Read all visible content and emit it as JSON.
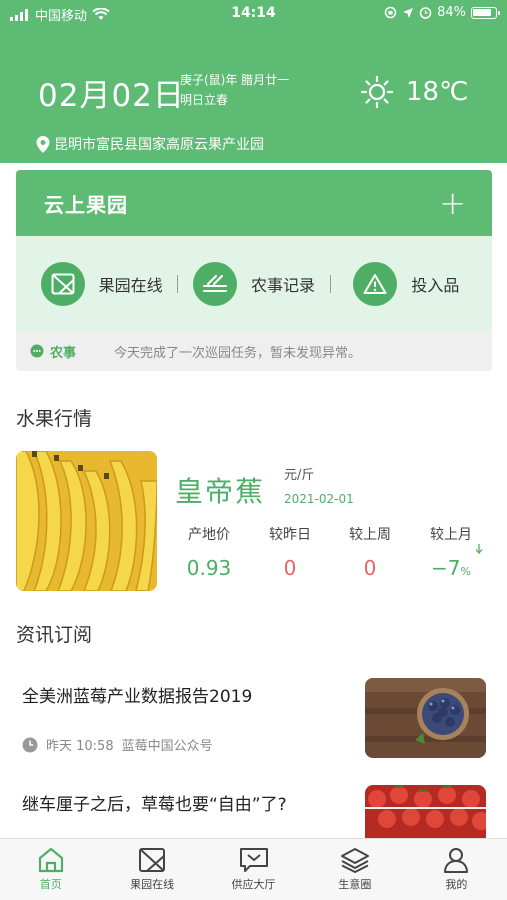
{
  "status_bar": {
    "carrier": "中国移动",
    "time": "14:14",
    "battery": "84%"
  },
  "header": {
    "date": "02月02日",
    "lunar_line1": "庚子(鼠)年 腊月廿一",
    "lunar_line2": "明日立春",
    "temperature": "18℃",
    "location": "昆明市富民县国家高原云果产业园"
  },
  "orchard_card": {
    "title": "云上果园",
    "functions": [
      {
        "label": "果园在线",
        "icon": "image-frame-icon"
      },
      {
        "label": "农事记录",
        "icon": "record-lines-icon"
      },
      {
        "label": "投入品",
        "icon": "warning-triangle-icon"
      }
    ],
    "notice_tag": "农事",
    "notice_text": "今天完成了一次巡园任务，暂未发现异常。"
  },
  "market": {
    "section_title": "水果行情",
    "fruit_name": "皇帝蕉",
    "unit": "元/斤",
    "date": "2021-02-01",
    "prices": [
      {
        "label": "产地价",
        "value": "0.93",
        "color": "#4fae66"
      },
      {
        "label": "较昨日",
        "value": "0",
        "color": "#e86666"
      },
      {
        "label": "较上周",
        "value": "0",
        "color": "#e86666"
      },
      {
        "label": "较上月",
        "value": "−7",
        "suffix": "%",
        "color": "#4fae66"
      }
    ]
  },
  "news_section": {
    "section_title": "资讯订阅",
    "items": [
      {
        "title": "全美洲蓝莓产业数据报告2019",
        "time": "昨天 10:58",
        "source": "蓝莓中国公众号"
      },
      {
        "title": "继车厘子之后，草莓也要“自由”了?"
      }
    ]
  },
  "tabbar": {
    "tabs": [
      {
        "label": "首页",
        "icon": "home-icon",
        "active": true
      },
      {
        "label": "果园在线",
        "icon": "image-frame-icon",
        "active": false
      },
      {
        "label": "供应大厅",
        "icon": "message-icon",
        "active": false
      },
      {
        "label": "生意圈",
        "icon": "layers-icon",
        "active": false
      },
      {
        "label": "我的",
        "icon": "user-icon",
        "active": false
      }
    ]
  },
  "colors": {
    "brand_green": "#5dbb74",
    "accent_green": "#4fae66",
    "light_green": "#e2f4e8",
    "down_red": "#e86666"
  }
}
